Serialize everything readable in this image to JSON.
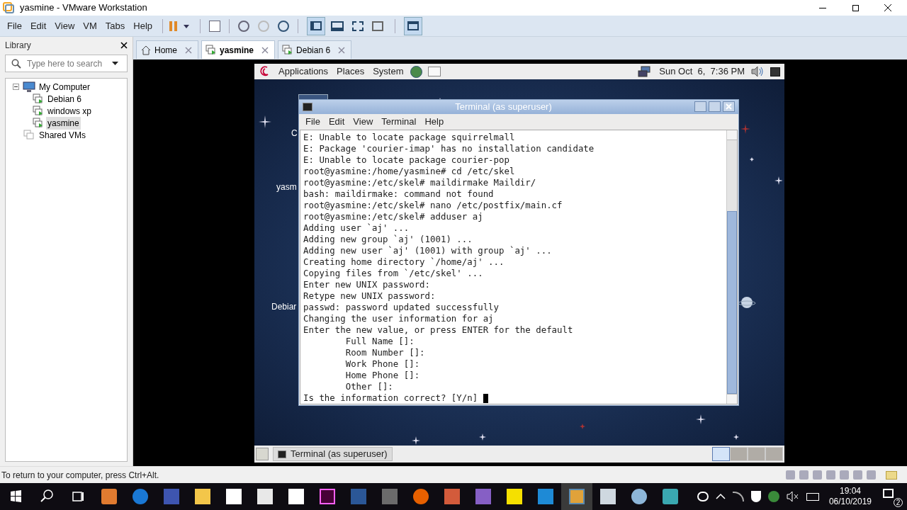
{
  "window": {
    "title": "yasmine - VMware Workstation"
  },
  "menu": [
    "File",
    "Edit",
    "View",
    "VM",
    "Tabs",
    "Help"
  ],
  "library": {
    "title": "Library",
    "search": {
      "placeholder": "Type here to search"
    },
    "tree": [
      {
        "label": "My Computer",
        "expanded": true,
        "children": [
          {
            "label": "Debian 6",
            "selected": false
          },
          {
            "label": "windows xp",
            "selected": false
          },
          {
            "label": "yasmine",
            "selected": true
          }
        ]
      },
      {
        "label": "Shared VMs"
      }
    ]
  },
  "tabs": [
    {
      "label": "Home",
      "kind": "home",
      "selected": false
    },
    {
      "label": "yasmine",
      "kind": "vm",
      "selected": true
    },
    {
      "label": "Debian 6",
      "kind": "vm",
      "selected": false
    }
  ],
  "guest": {
    "panel": {
      "menus": [
        "Applications",
        "Places",
        "System"
      ],
      "clock": "Sun Oct  6,  7:36 PM"
    },
    "desktop_icons": [
      "C",
      "yasm",
      "Debiar"
    ],
    "terminal": {
      "title": "Terminal (as superuser)",
      "menu": [
        "File",
        "Edit",
        "View",
        "Terminal",
        "Help"
      ],
      "lines": [
        "E: Unable to locate package squirrelmall",
        "E: Package 'courier-imap' has no installation candidate",
        "E: Unable to locate package courier-pop",
        "root@yasmine:/home/yasmine# cd /etc/skel",
        "root@yasmine:/etc/skel# maildirmake Maildir/",
        "bash: maildirmake: command not found",
        "root@yasmine:/etc/skel# nano /etc/postfix/main.cf",
        "root@yasmine:/etc/skel# adduser aj",
        "Adding user `aj' ...",
        "Adding new group `aj' (1001) ...",
        "Adding new user `aj' (1001) with group `aj' ...",
        "Creating home directory `/home/aj' ...",
        "Copying files from `/etc/skel' ...",
        "Enter new UNIX password:",
        "Retype new UNIX password:",
        "passwd: password updated successfully",
        "Changing the user information for aj",
        "Enter the new value, or press ENTER for the default",
        "        Full Name []:",
        "        Room Number []:",
        "        Work Phone []:",
        "        Home Phone []:",
        "        Other []:",
        "Is the information correct? [Y/n] "
      ]
    },
    "bottom_panel": {
      "task": "Terminal (as superuser)",
      "workspaces": [
        {
          "selected": true
        },
        {
          "selected": false
        },
        {
          "selected": false
        },
        {
          "selected": false
        }
      ]
    }
  },
  "status_bar": "To return to your computer, press Ctrl+Alt.",
  "taskbar": {
    "time": "19:04",
    "date": "06/10/2019",
    "notifications": "2"
  }
}
